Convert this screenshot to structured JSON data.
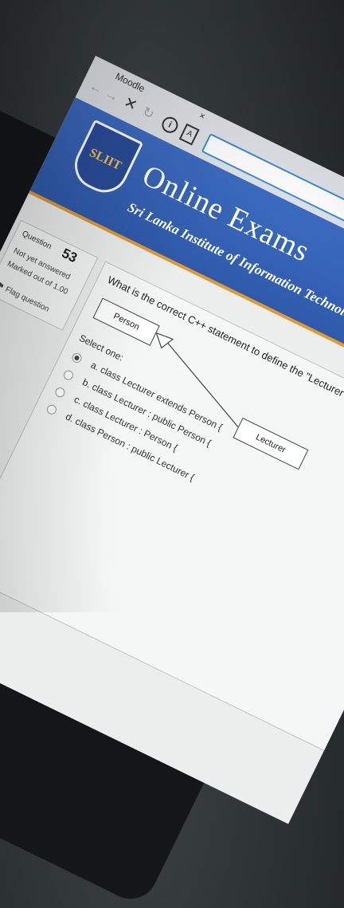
{
  "browser": {
    "tab_title": "Moodle",
    "nav": {
      "back": "←",
      "forward": "→",
      "stop": "✕",
      "reload": "↻"
    },
    "icons": {
      "info": "i",
      "document": "A",
      "close": "×"
    }
  },
  "banner": {
    "logo_text": "SLIIT",
    "title": "Online Exams",
    "subtitle": "Sri Lanka Institute of Information Technology"
  },
  "question_info": {
    "label": "Question",
    "number": "53",
    "status": "Not yet answered",
    "marked_out_of": "Marked out of 1.00",
    "flag": "Flag question"
  },
  "question": {
    "text": "What is the correct C++ statement to define the \"Lecturer\" class according",
    "diagram": {
      "parent_class": "Person",
      "child_class": "Lecturer"
    },
    "select_label": "Select one:",
    "options": [
      {
        "label": "a. class Lecturer extends Person {",
        "selected": true
      },
      {
        "label": "b. class Lecturer : public Person {",
        "selected": false
      },
      {
        "label": "c. class Lecturer : Person {",
        "selected": false
      },
      {
        "label": "d. class Person : public Lecturer {",
        "selected": false
      }
    ]
  },
  "colors": {
    "banner_blue": "#3c6cc1",
    "accent_orange": "#e39a2c",
    "url_focus": "#3a8fd8"
  }
}
